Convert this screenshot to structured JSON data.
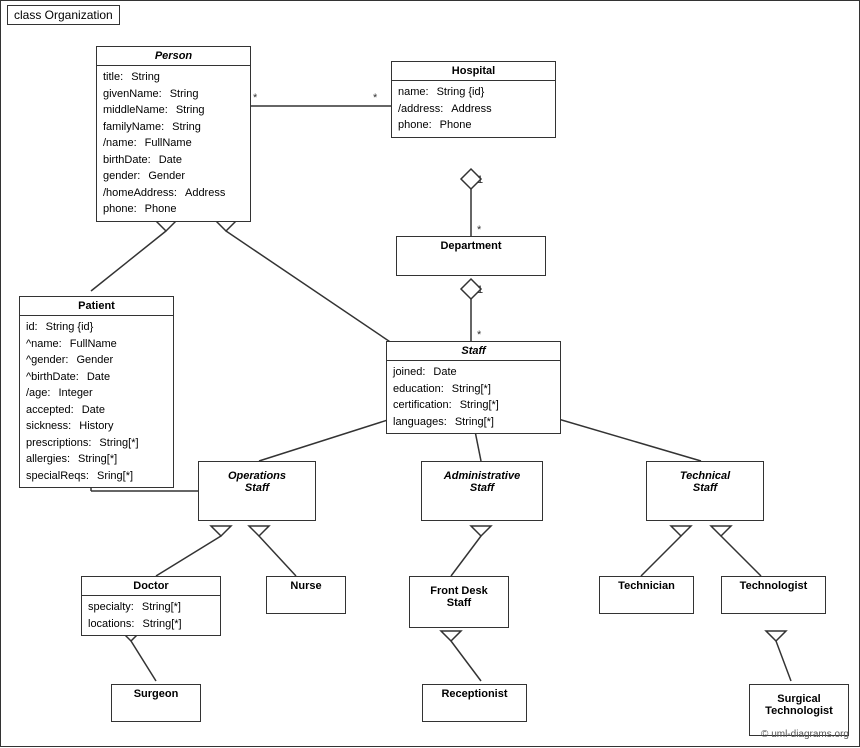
{
  "diagram": {
    "title": "class Organization",
    "copyright": "© uml-diagrams.org",
    "classes": {
      "person": {
        "name": "Person",
        "italic": true,
        "attrs": [
          {
            "name": "title:",
            "type": "String"
          },
          {
            "name": "givenName:",
            "type": "String"
          },
          {
            "name": "middleName:",
            "type": "String"
          },
          {
            "name": "familyName:",
            "type": "String"
          },
          {
            "name": "/name:",
            "type": "FullName"
          },
          {
            "name": "birthDate:",
            "type": "Date"
          },
          {
            "name": "gender:",
            "type": "Gender"
          },
          {
            "name": "/homeAddress:",
            "type": "Address"
          },
          {
            "name": "phone:",
            "type": "Phone"
          }
        ]
      },
      "hospital": {
        "name": "Hospital",
        "italic": false,
        "attrs": [
          {
            "name": "name:",
            "type": "String {id}"
          },
          {
            "name": "/address:",
            "type": "Address"
          },
          {
            "name": "phone:",
            "type": "Phone"
          }
        ]
      },
      "patient": {
        "name": "Patient",
        "italic": false,
        "attrs": [
          {
            "name": "id:",
            "type": "String {id}"
          },
          {
            "name": "^name:",
            "type": "FullName"
          },
          {
            "name": "^gender:",
            "type": "Gender"
          },
          {
            "name": "^birthDate:",
            "type": "Date"
          },
          {
            "name": "/age:",
            "type": "Integer"
          },
          {
            "name": "accepted:",
            "type": "Date"
          },
          {
            "name": "sickness:",
            "type": "History"
          },
          {
            "name": "prescriptions:",
            "type": "String[*]"
          },
          {
            "name": "allergies:",
            "type": "String[*]"
          },
          {
            "name": "specialReqs:",
            "type": "Sring[*]"
          }
        ]
      },
      "department": {
        "name": "Department",
        "italic": false,
        "attrs": []
      },
      "staff": {
        "name": "Staff",
        "italic": true,
        "attrs": [
          {
            "name": "joined:",
            "type": "Date"
          },
          {
            "name": "education:",
            "type": "String[*]"
          },
          {
            "name": "certification:",
            "type": "String[*]"
          },
          {
            "name": "languages:",
            "type": "String[*]"
          }
        ]
      },
      "operations_staff": {
        "name": "Operations\nStaff",
        "italic": true,
        "attrs": []
      },
      "administrative_staff": {
        "name": "Administrative\nStaff",
        "italic": true,
        "attrs": []
      },
      "technical_staff": {
        "name": "Technical\nStaff",
        "italic": true,
        "attrs": []
      },
      "doctor": {
        "name": "Doctor",
        "italic": false,
        "attrs": [
          {
            "name": "specialty:",
            "type": "String[*]"
          },
          {
            "name": "locations:",
            "type": "String[*]"
          }
        ]
      },
      "nurse": {
        "name": "Nurse",
        "italic": false,
        "attrs": []
      },
      "front_desk_staff": {
        "name": "Front Desk\nStaff",
        "italic": false,
        "attrs": []
      },
      "technician": {
        "name": "Technician",
        "italic": false,
        "attrs": []
      },
      "technologist": {
        "name": "Technologist",
        "italic": false,
        "attrs": []
      },
      "surgeon": {
        "name": "Surgeon",
        "italic": false,
        "attrs": []
      },
      "receptionist": {
        "name": "Receptionist",
        "italic": false,
        "attrs": []
      },
      "surgical_technologist": {
        "name": "Surgical\nTechnologist",
        "italic": false,
        "attrs": []
      }
    }
  }
}
